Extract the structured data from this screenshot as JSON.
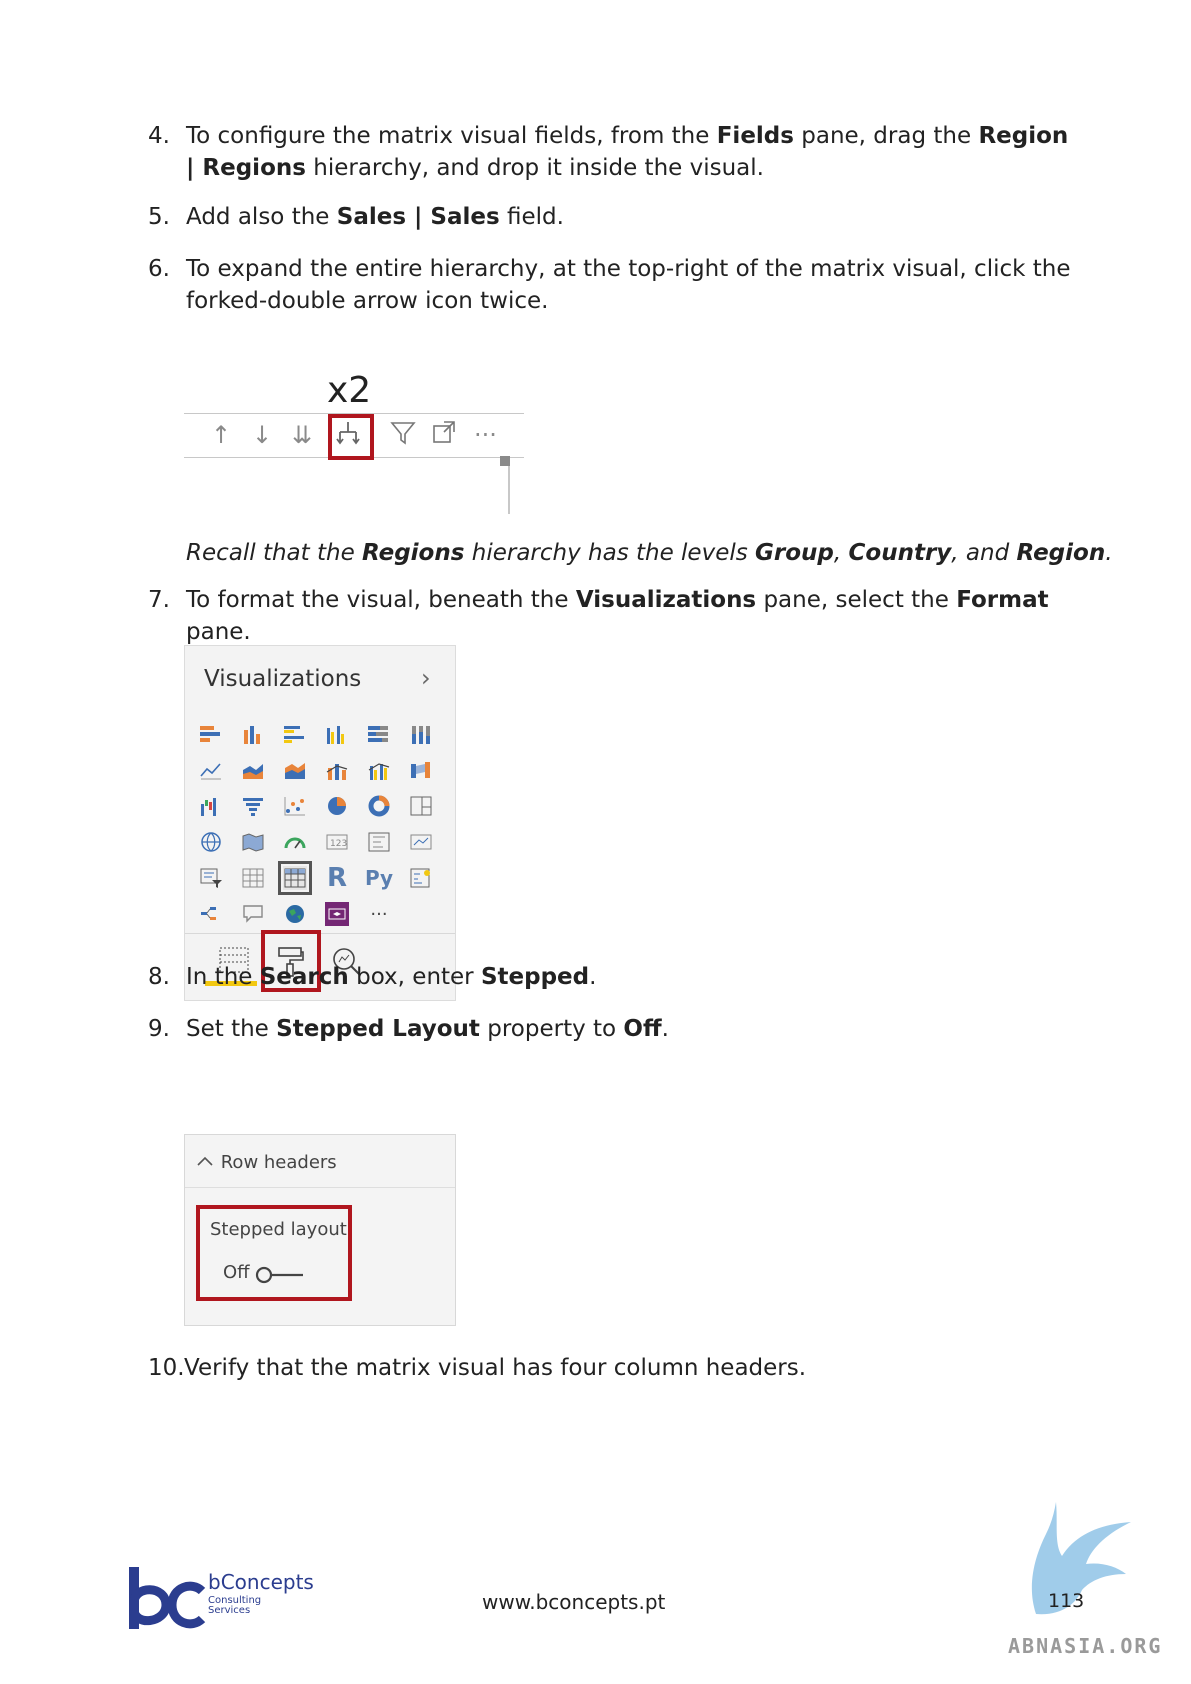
{
  "steps": [
    {
      "num": "4.",
      "parts": [
        {
          "t": "To configure the matrix visual fields, from the ",
          "b": false
        },
        {
          "t": "Fields",
          "b": true
        },
        {
          "t": " pane, drag the ",
          "b": false
        },
        {
          "t": "Region | Regions",
          "b": true
        },
        {
          "t": " hierarchy, and drop it inside the visual.",
          "b": false
        }
      ]
    },
    {
      "num": "5.",
      "parts": [
        {
          "t": "Add also the ",
          "b": false
        },
        {
          "t": "Sales | Sales",
          "b": true
        },
        {
          "t": " field.",
          "b": false
        }
      ]
    },
    {
      "num": "6.",
      "parts": [
        {
          "t": "To expand the entire hierarchy, at the top-right of the matrix visual, click the forked-double arrow icon twice.",
          "b": false
        }
      ]
    },
    {
      "num": "7.",
      "parts": [
        {
          "t": "To format the visual, beneath the ",
          "b": false
        },
        {
          "t": "Visualizations",
          "b": true
        },
        {
          "t": " pane, select the ",
          "b": false
        },
        {
          "t": "Format",
          "b": true
        },
        {
          "t": " pane.",
          "b": false
        }
      ]
    },
    {
      "num": "8.",
      "parts": [
        {
          "t": "In the ",
          "b": false
        },
        {
          "t": "Search",
          "b": true
        },
        {
          "t": " box, enter ",
          "b": false
        },
        {
          "t": "Stepped",
          "b": true
        },
        {
          "t": ".",
          "b": false
        }
      ]
    },
    {
      "num": "9.",
      "parts": [
        {
          "t": "Set the ",
          "b": false
        },
        {
          "t": "Stepped Layout",
          "b": true
        },
        {
          "t": " property to ",
          "b": false
        },
        {
          "t": "Off",
          "b": true
        },
        {
          "t": ".",
          "b": false
        }
      ]
    },
    {
      "num": "10.",
      "parts": [
        {
          "t": "Verify that the matrix visual has four column headers.",
          "b": false
        }
      ]
    }
  ],
  "note": {
    "parts": [
      {
        "t": "Recall that the ",
        "b": false
      },
      {
        "t": "Regions",
        "b": true
      },
      {
        "t": " hierarchy has the levels ",
        "b": false
      },
      {
        "t": "Group",
        "b": true
      },
      {
        "t": ", ",
        "b": false
      },
      {
        "t": "Country",
        "b": true
      },
      {
        "t": ", and ",
        "b": false
      },
      {
        "t": "Region",
        "b": true
      },
      {
        "t": ".",
        "b": false
      }
    ]
  },
  "figure1": {
    "label": "x2"
  },
  "figure2": {
    "title": "Visualizations"
  },
  "figure3": {
    "section": "Row headers",
    "property": "Stepped layout",
    "value": "Off"
  },
  "footer": {
    "brand": "bConcepts",
    "brand_sub1": "Consulting",
    "brand_sub2": "Services",
    "url": "www.bconcepts.pt",
    "page": "113",
    "watermark": "ABNASIA.ORG"
  },
  "colors": {
    "highlight": "#b0161e",
    "brand": "#2b3d8f",
    "accent_yellow": "#f2c811"
  }
}
